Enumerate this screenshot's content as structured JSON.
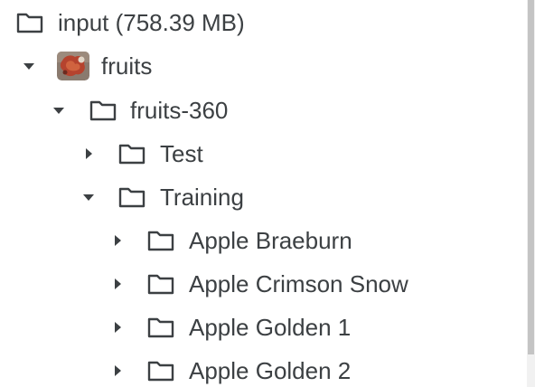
{
  "tree": {
    "root": {
      "label": "input (758.39 MB)",
      "icon": "folder-icon"
    },
    "dataset": {
      "label": "fruits",
      "icon": "dataset-thumbnail",
      "caret": "caret-down-icon"
    },
    "folder": {
      "label": "fruits-360",
      "icon": "folder-icon",
      "caret": "caret-down-icon"
    },
    "test": {
      "label": "Test",
      "icon": "folder-icon",
      "caret": "caret-right-icon"
    },
    "training": {
      "label": "Training",
      "icon": "folder-icon",
      "caret": "caret-down-icon"
    },
    "items": [
      {
        "label": "Apple Braeburn",
        "icon": "folder-icon",
        "caret": "caret-right-icon"
      },
      {
        "label": "Apple Crimson Snow",
        "icon": "folder-icon",
        "caret": "caret-right-icon"
      },
      {
        "label": "Apple Golden 1",
        "icon": "folder-icon",
        "caret": "caret-right-icon"
      },
      {
        "label": "Apple Golden 2",
        "icon": "folder-icon",
        "caret": "caret-right-icon"
      }
    ]
  },
  "colors": {
    "text": "#3c4043",
    "icon": "#3c4043",
    "scrollbar_track": "#f1f1f1",
    "scrollbar_thumb": "#c4c4c4"
  }
}
